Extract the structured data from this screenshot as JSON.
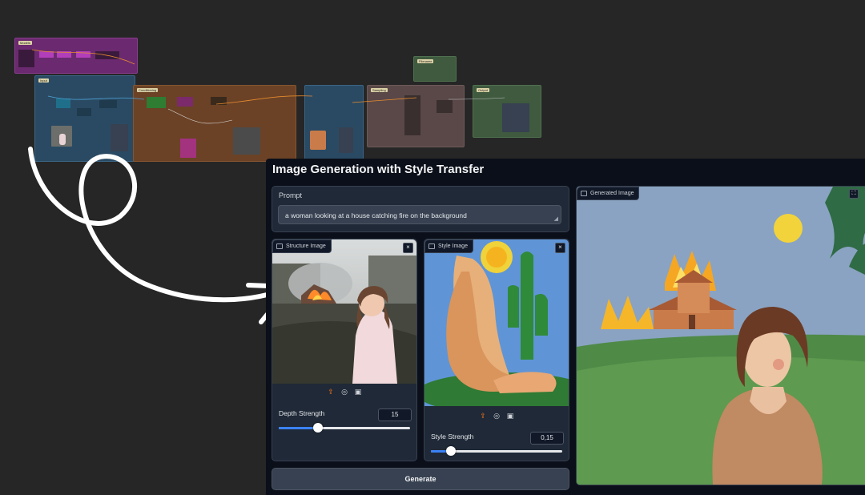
{
  "graph": {
    "nodes": [
      {
        "title": "Models",
        "color": "#6b2a6f"
      },
      {
        "title": "Input",
        "color": "#2a4a63"
      },
      {
        "title": "Conditioning",
        "color": "#6b4226"
      },
      {
        "title": "Sampling",
        "color": "#5a4848"
      },
      {
        "title": "Output",
        "color": "#3f5a3f"
      },
      {
        "title": "Filename",
        "color": "#3f5a3f"
      }
    ]
  },
  "app": {
    "title": "Image Generation with Style Transfer",
    "prompt": {
      "label": "Prompt",
      "value": "a woman looking at a house catching fire on the background"
    },
    "structure_image": {
      "label": "Structure Image",
      "slider_label": "Depth Strength",
      "value": 15,
      "min": 0,
      "max": 50,
      "value_text": "15"
    },
    "style_image": {
      "label": "Style Image",
      "slider_label": "Style Strength",
      "value": 0.15,
      "min": 0,
      "max": 1,
      "value_text": "0,15"
    },
    "generate_label": "Generate",
    "output": {
      "label": "Generated Image"
    }
  },
  "colors": {
    "accent": "#3b82f6",
    "upload_icon": "#f97316",
    "panel_bg": "#0b0f19",
    "block_bg": "#1f2937"
  },
  "icons": [
    "image-icon",
    "close-icon",
    "upload-icon",
    "webcam-icon",
    "clipboard-icon",
    "fullscreen-icon",
    "resize-grip-icon"
  ]
}
